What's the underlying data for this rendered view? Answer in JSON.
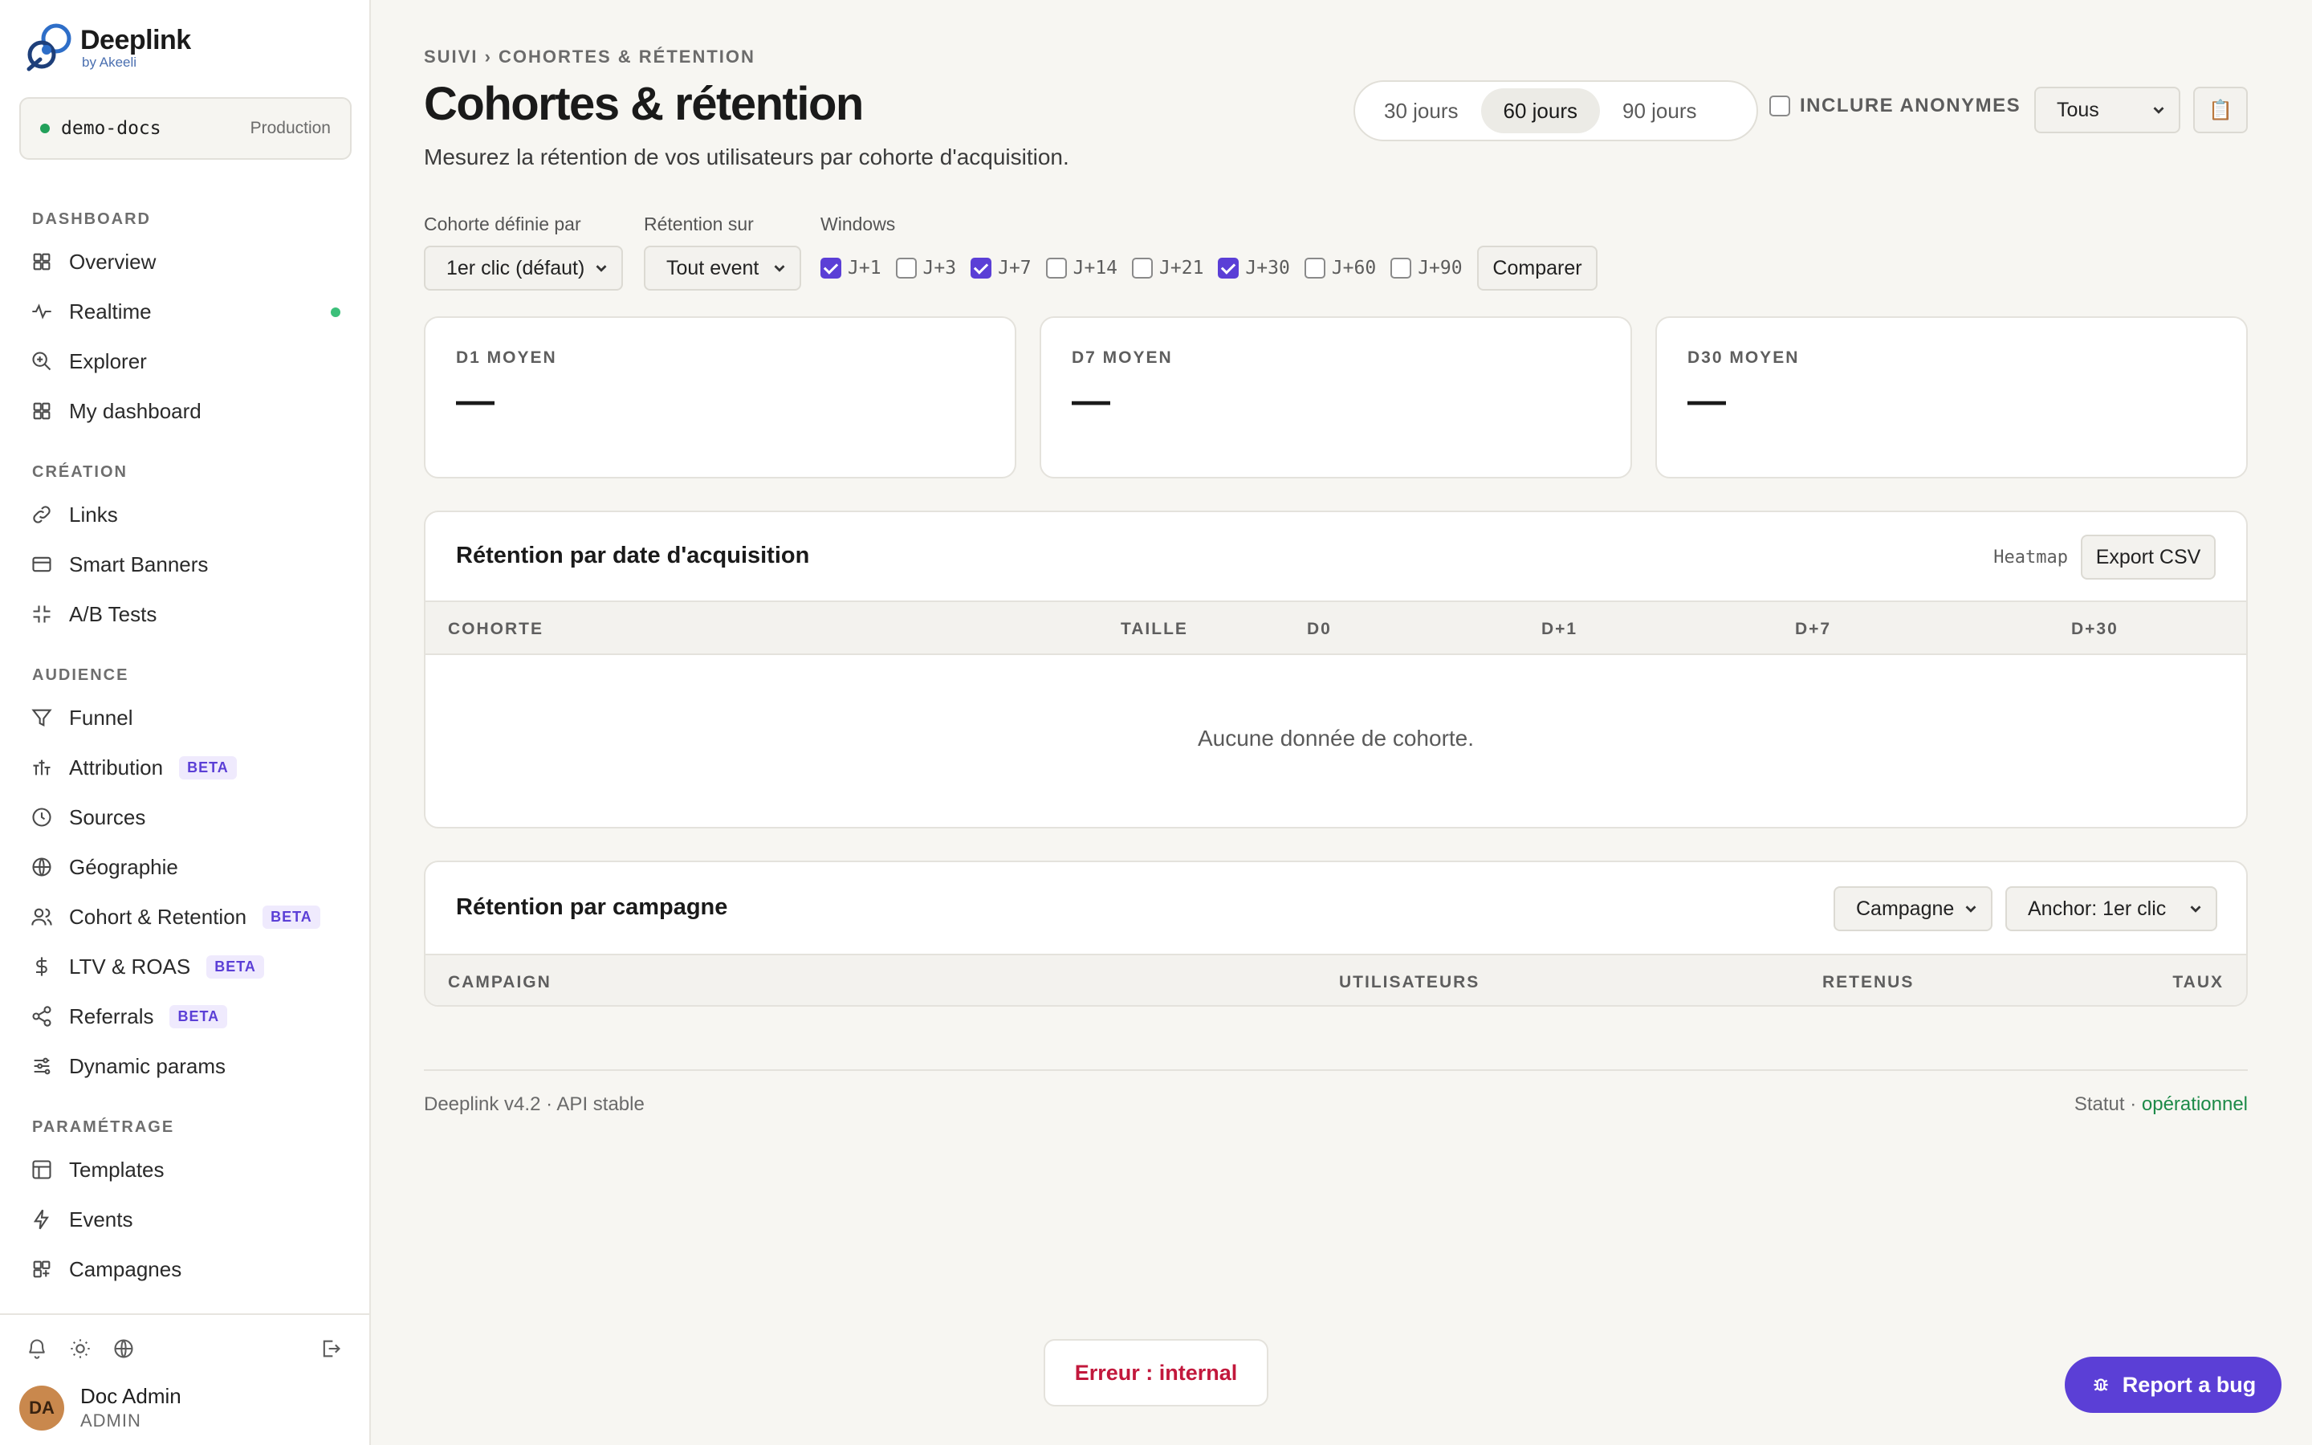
{
  "brand": {
    "name": "Deeplink",
    "sub": "by Akeeli"
  },
  "project": {
    "name": "demo-docs",
    "env": "Production"
  },
  "sidebar": {
    "sections": [
      {
        "heading": "DASHBOARD",
        "items": [
          {
            "label": "Overview",
            "icon": "grid-icon"
          },
          {
            "label": "Realtime",
            "icon": "pulse-icon",
            "live": true
          },
          {
            "label": "Explorer",
            "icon": "zoom-in-icon"
          },
          {
            "label": "My dashboard",
            "icon": "grid-icon"
          }
        ]
      },
      {
        "heading": "CRÉATION",
        "items": [
          {
            "label": "Links",
            "icon": "link-icon"
          },
          {
            "label": "Smart Banners",
            "icon": "banner-icon"
          },
          {
            "label": "A/B Tests",
            "icon": "split-icon"
          }
        ]
      },
      {
        "heading": "AUDIENCE",
        "items": [
          {
            "label": "Funnel",
            "icon": "funnel-icon"
          },
          {
            "label": "Attribution",
            "icon": "sliders-icon",
            "badge": "BETA"
          },
          {
            "label": "Sources",
            "icon": "clock-icon"
          },
          {
            "label": "Géographie",
            "icon": "globe-icon"
          },
          {
            "label": "Cohort & Retention",
            "icon": "users-icon",
            "badge": "BETA"
          },
          {
            "label": "LTV & ROAS",
            "icon": "dollar-icon",
            "badge": "BETA"
          },
          {
            "label": "Referrals",
            "icon": "share-icon",
            "badge": "BETA"
          },
          {
            "label": "Dynamic params",
            "icon": "settings-sliders-icon"
          }
        ]
      },
      {
        "heading": "PARAMÉTRAGE",
        "items": [
          {
            "label": "Templates",
            "icon": "template-icon"
          },
          {
            "label": "Events",
            "icon": "bolt-icon"
          },
          {
            "label": "Campagnes",
            "icon": "grid-plus-icon"
          }
        ]
      }
    ]
  },
  "user": {
    "initials": "DA",
    "name": "Doc Admin",
    "role": "ADMIN"
  },
  "header": {
    "breadcrumb": "SUIVI › COHORTES & RÉTENTION",
    "title": "Cohortes & rétention",
    "subtitle": "Mesurez la rétention de vos utilisateurs par cohorte d'acquisition.",
    "ranges": [
      "30 jours",
      "60 jours",
      "90 jours"
    ],
    "active_range": "60 jours",
    "include_anon_label": "INCLURE ANONYMES",
    "include_anon": false,
    "segment": "Tous",
    "calendar_icon": "📋"
  },
  "filters": {
    "cohort_label": "Cohorte définie par",
    "cohort_value": "1er clic (défaut)",
    "retention_label": "Rétention sur",
    "retention_value": "Tout event",
    "windows_label": "Windows",
    "windows": [
      {
        "label": "J+1",
        "checked": true
      },
      {
        "label": "J+3",
        "checked": false
      },
      {
        "label": "J+7",
        "checked": true
      },
      {
        "label": "J+14",
        "checked": false
      },
      {
        "label": "J+21",
        "checked": false
      },
      {
        "label": "J+30",
        "checked": true
      },
      {
        "label": "J+60",
        "checked": false
      },
      {
        "label": "J+90",
        "checked": false
      }
    ],
    "compare_label": "Comparer"
  },
  "stats": [
    {
      "label": "D1 MOYEN",
      "value": "—"
    },
    {
      "label": "D7 MOYEN",
      "value": "—"
    },
    {
      "label": "D30 MOYEN",
      "value": "—"
    }
  ],
  "retention_table": {
    "title": "Rétention par date d'acquisition",
    "heatmap_label": "Heatmap",
    "export_label": "Export CSV",
    "columns": [
      "COHORTE",
      "TAILLE",
      "D0",
      "D+1",
      "D+7",
      "D+30"
    ],
    "empty": "Aucune donnée de cohorte."
  },
  "campaign_table": {
    "title": "Rétention par campagne",
    "group_by": "Campagne",
    "anchor": "Anchor: 1er clic",
    "columns": [
      "CAMPAIGN",
      "UTILISATEURS",
      "RETENUS",
      "TAUX"
    ]
  },
  "footer": {
    "version": "Deeplink v4.2 · API stable",
    "status_prefix": "Statut ·",
    "status_value": "opérationnel"
  },
  "toast": {
    "error": "Erreur : internal"
  },
  "report_bug": "Report a bug",
  "colors": {
    "accent": "#5b3fd6",
    "ok": "#1c8a48",
    "error": "#c2183c",
    "live": "#3cc07a"
  }
}
